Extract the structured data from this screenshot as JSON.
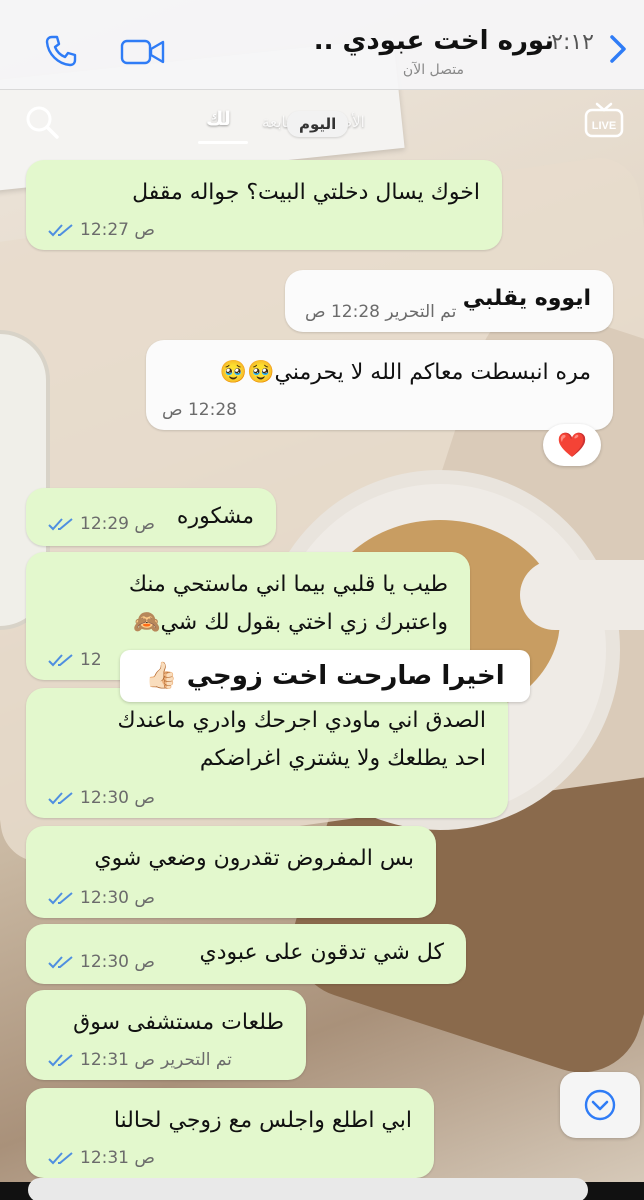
{
  "header": {
    "title": "نوره اخت عبودي ..",
    "time": "٢:١٢",
    "status": "متصل الآن",
    "call_icon": "phone-icon",
    "video_icon": "video-camera-icon",
    "back_icon": "chevron-right-icon"
  },
  "overlay": {
    "tab_friends": "الأصدقاء المتابعة",
    "tab_you": "لك",
    "date": "اليوم",
    "search_icon": "search-icon",
    "live_icon": "live-tv-icon",
    "live_label": "LIVE"
  },
  "messages": [
    {
      "text": "اخوك يسال دخلتي البيت؟ جواله مقفل",
      "time": "12:27 ص",
      "dir": "out"
    },
    {
      "text": "ايووه يقلبي",
      "time": "12:28 ص",
      "edited": "تم التحرير",
      "dir": "in"
    },
    {
      "text": "مره انبسطت معاكم الله لا يحرمني🥹🥹",
      "time": "12:28 ص",
      "dir": "in",
      "reaction": "❤️"
    },
    {
      "text": "مشكوره",
      "time": "12:29 ص",
      "dir": "out"
    },
    {
      "line1": "طيب يا قلبي بيما اني ماستحي منك",
      "line2": "واعتبرك زي اختي بقول لك شي🙈",
      "time": "12",
      "dir": "out"
    },
    {
      "line1": "الصدق اني ماودي اجرحك وادري ماعندك",
      "line2": "احد يطلعك ولا يشتري اغراضكم",
      "time": "12:30 ص",
      "dir": "out"
    },
    {
      "text": "بس المفروض تقدرون وضعي شوي",
      "time": "12:30 ص",
      "dir": "out"
    },
    {
      "text": "كل شي تدقون على عبودي",
      "time": "12:30 ص",
      "dir": "out"
    },
    {
      "text": "طلعات مستشفى سوق",
      "time": "12:31 ص",
      "edited": "تم التحرير",
      "dir": "out"
    },
    {
      "text": "ابي اطلع واجلس مع زوجي لحالنا",
      "time": "12:31 ص",
      "dir": "out"
    }
  ],
  "caption": "اخيرا صارحت اخت زوجي 👍🏻",
  "scroll_icon": "chevron-down-circle-icon",
  "colors": {
    "outgoing": "#e3f8cd",
    "incoming": "#fbfbfb",
    "ticks": "#4f8fe0",
    "ios_blue": "#2f7cf6"
  }
}
